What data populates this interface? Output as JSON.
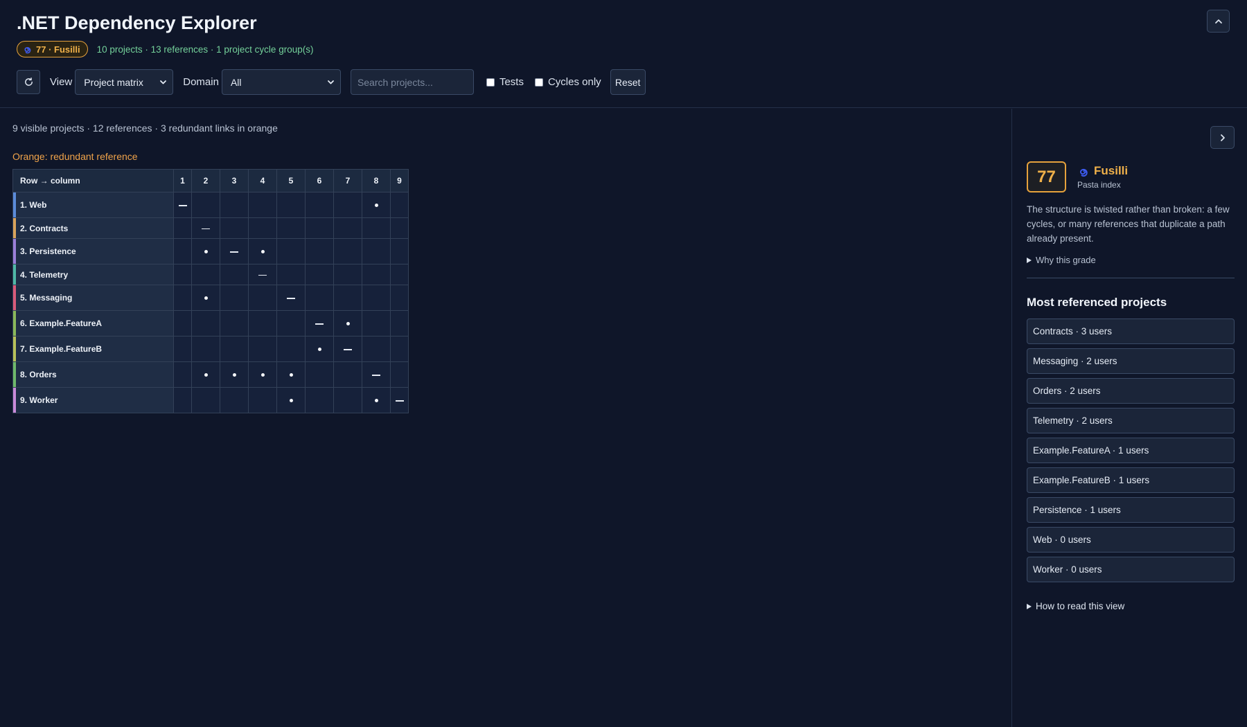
{
  "header": {
    "title": ".NET Dependency Explorer",
    "grade_badge": "77 · Fusilli",
    "summary": "10 projects · 13 references · 1 project cycle group(s)"
  },
  "toolbar": {
    "view_label": "View",
    "view_value": "Project matrix",
    "domain_label": "Domain",
    "domain_value": "All",
    "search_placeholder": "Search projects...",
    "tests_label": "Tests",
    "tests_checked": false,
    "cycles_label": "Cycles only",
    "cycles_checked": false,
    "reset_label": "Reset"
  },
  "main": {
    "visible_summary": "9 visible projects · 12 references · 3 redundant links in orange",
    "legend_text": "Orange: redundant reference",
    "matrix": {
      "corner_label": "Row → column",
      "columns": [
        "1",
        "2",
        "3",
        "4",
        "5",
        "6",
        "7",
        "8",
        "9"
      ],
      "rows": [
        {
          "label": "1. Web",
          "accent": "#5b8bd9",
          "cells": [
            "self",
            "",
            "",
            "",
            "",
            "",
            "",
            "blue",
            ""
          ]
        },
        {
          "label": "2. Contracts",
          "accent": "#d9a35b",
          "cells": [
            "",
            "self",
            "",
            "",
            "",
            "",
            "",
            "",
            ""
          ]
        },
        {
          "label": "3. Persistence",
          "accent": "#9b7fd9",
          "cells": [
            "",
            "blue",
            "self",
            "blue",
            "",
            "",
            "",
            "",
            ""
          ]
        },
        {
          "label": "4. Telemetry",
          "accent": "#4fb8a6",
          "cells": [
            "",
            "",
            "",
            "self",
            "",
            "",
            "",
            "",
            ""
          ]
        },
        {
          "label": "5. Messaging",
          "accent": "#d95b7a",
          "cells": [
            "",
            "blue",
            "",
            "",
            "self",
            "",
            "",
            "",
            ""
          ]
        },
        {
          "label": "6. Example.FeatureA",
          "accent": "#8ab85a",
          "cells": [
            "",
            "",
            "",
            "",
            "",
            "self",
            "red",
            "",
            ""
          ]
        },
        {
          "label": "7. Example.FeatureB",
          "accent": "#b8c25a",
          "cells": [
            "",
            "",
            "",
            "",
            "",
            "red",
            "self",
            "",
            ""
          ]
        },
        {
          "label": "8. Orders",
          "accent": "#6fb86a",
          "cells": [
            "",
            "orange",
            "blue",
            "orange",
            "blue",
            "",
            "",
            "self",
            ""
          ]
        },
        {
          "label": "9. Worker",
          "accent": "#c98ad9",
          "cells": [
            "",
            "",
            "",
            "",
            "orange",
            "",
            "",
            "blue",
            "self"
          ]
        }
      ]
    }
  },
  "panel": {
    "score": "77",
    "grade_name": "Fusilli",
    "grade_sub": "Pasta index",
    "description": "The structure is twisted rather than broken: a few cycles, or many references that duplicate a path already present.",
    "why_grade": "Why this grade",
    "most_title": "Most referenced projects",
    "refs": [
      "Contracts · 3 users",
      "Messaging · 2 users",
      "Orders · 2 users",
      "Telemetry · 2 users",
      "Example.FeatureA · 1 users",
      "Example.FeatureB · 1 users",
      "Persistence · 1 users",
      "Web · 0 users",
      "Worker · 0 users"
    ],
    "how_to_read": "How to read this view"
  },
  "colors": {
    "accent_orange": "#e6a23c",
    "summary_green": "#74d19a",
    "cell_blue": "#264b6e",
    "cell_red": "#7d3348",
    "cell_orange": "#7a4f23",
    "spiral_icon": "#3d5bf0"
  },
  "icons": [
    "chevron-up-icon",
    "refresh-icon",
    "chevron-down-icon",
    "chevron-right-icon",
    "spiral-icon",
    "triangle-right-icon"
  ]
}
